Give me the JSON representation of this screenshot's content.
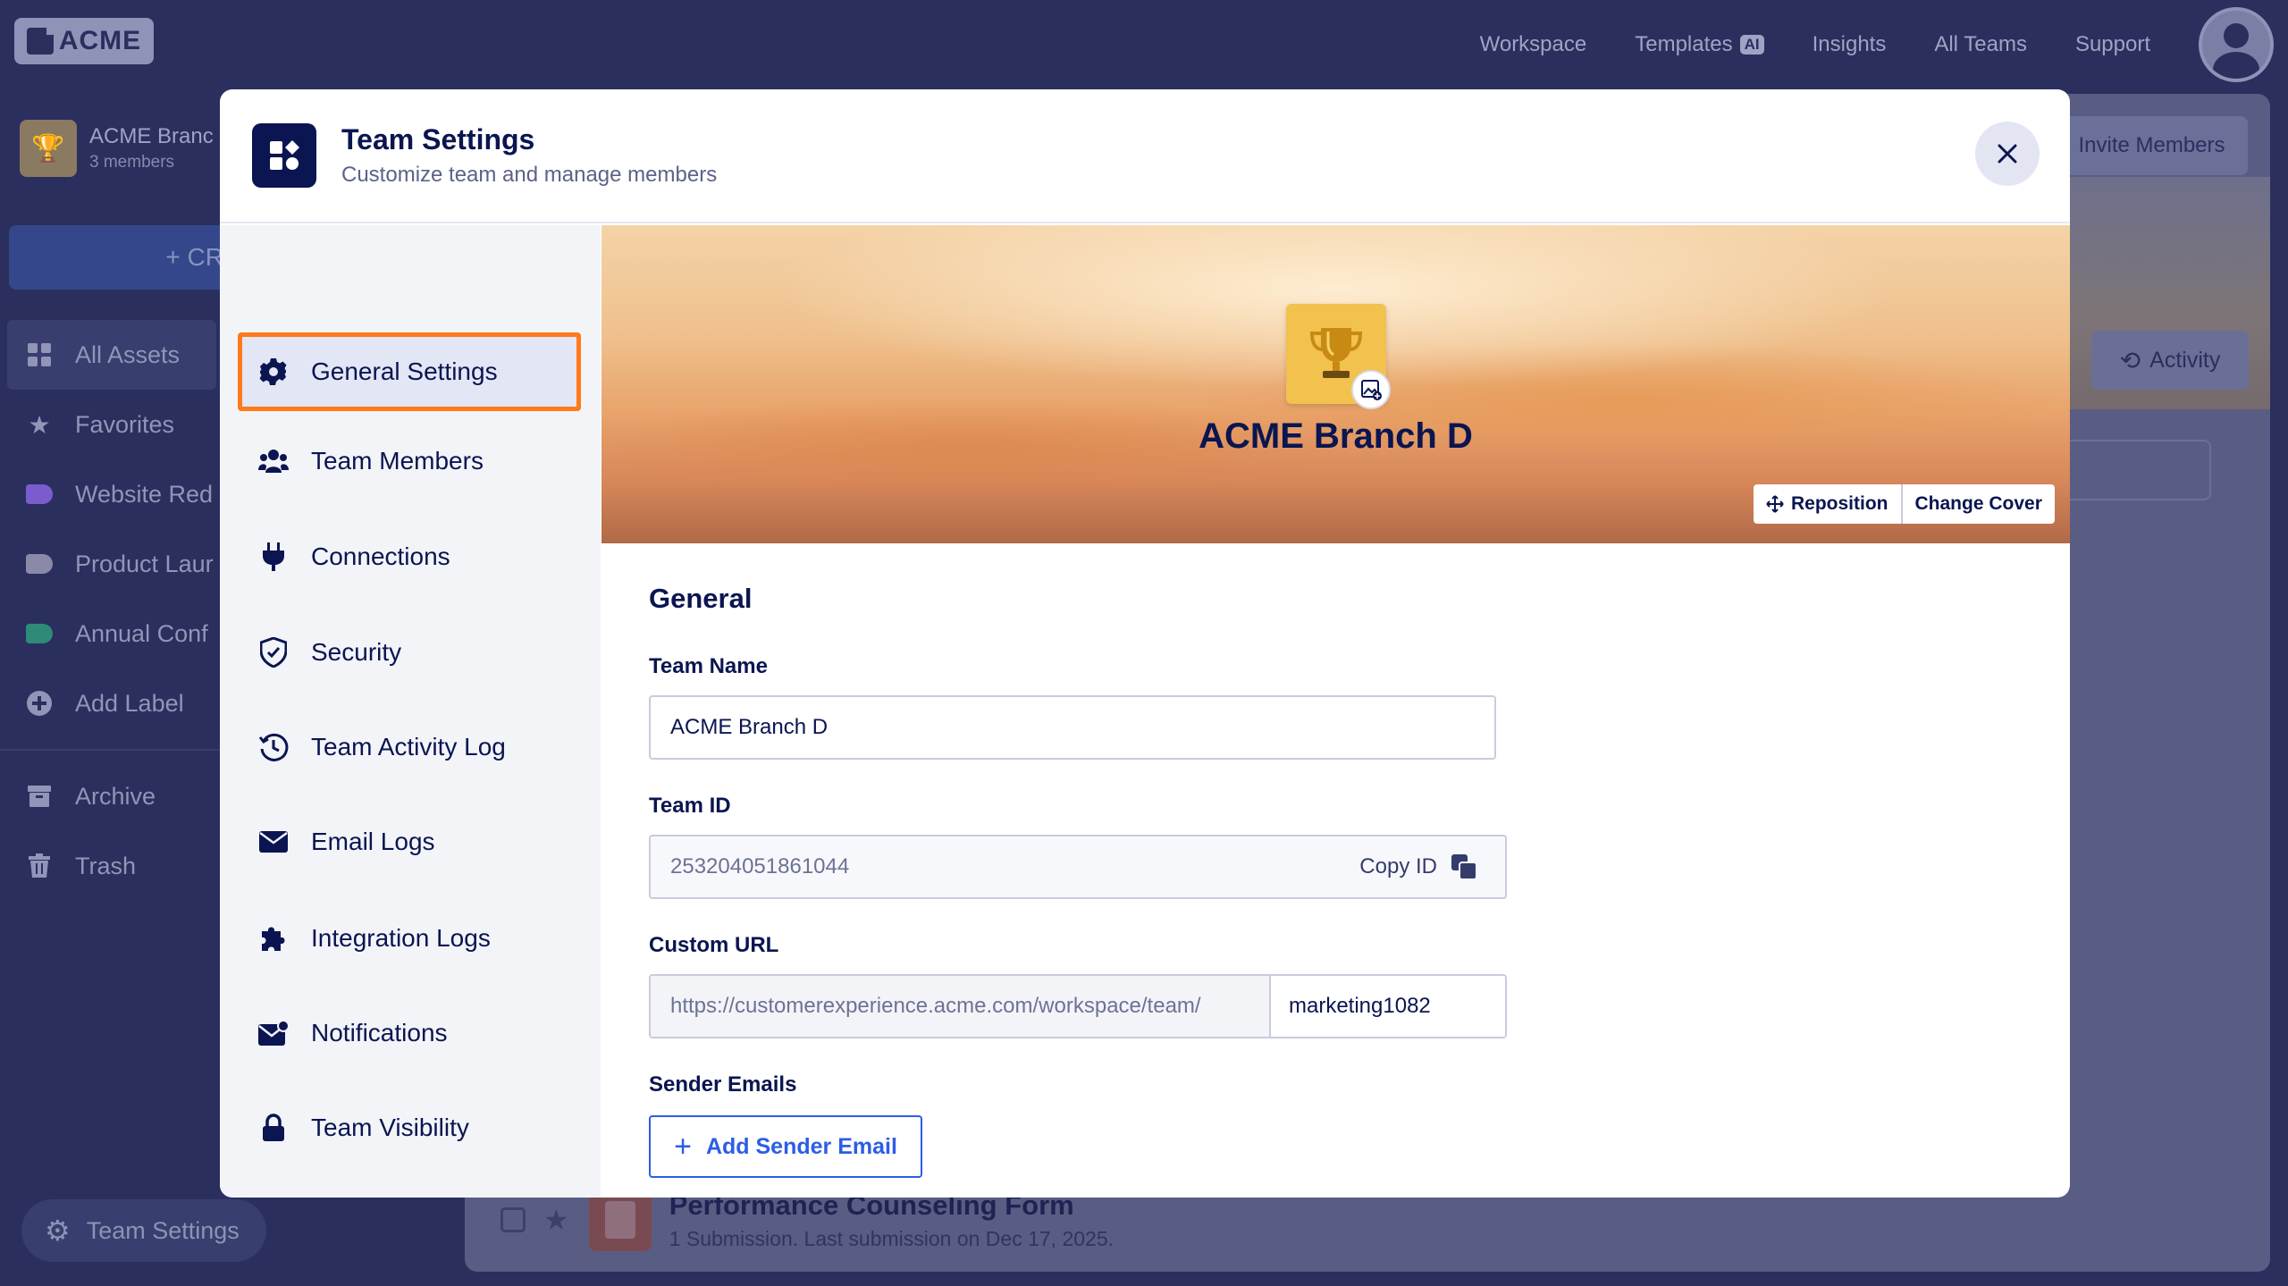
{
  "app": {
    "logo_text": "ACME",
    "nav": [
      {
        "label": "Workspace"
      },
      {
        "label": "Templates",
        "badge": "AI"
      },
      {
        "label": "Insights"
      },
      {
        "label": "All Teams"
      },
      {
        "label": "Support"
      }
    ]
  },
  "sidebar": {
    "team_name": "ACME Branc",
    "team_members": "3 members",
    "create_label": "+ CR",
    "items": [
      {
        "label": "All Assets",
        "icon": "grid-icon"
      },
      {
        "label": "Favorites",
        "icon": "star-icon"
      },
      {
        "label": "Website Red",
        "icon": "label-icon",
        "color": "#7b5ccf"
      },
      {
        "label": "Product Laur",
        "icon": "label-icon",
        "color": "#8a8aa8"
      },
      {
        "label": "Annual Conf",
        "icon": "label-icon",
        "color": "#2f8a78"
      },
      {
        "label": "Add Label",
        "icon": "plus-circle-icon"
      }
    ],
    "bottom_items": [
      {
        "label": "Archive",
        "icon": "archive-icon"
      },
      {
        "label": "Trash",
        "icon": "trash-icon"
      }
    ],
    "team_settings_label": "Team Settings"
  },
  "background": {
    "invite_label": "Invite Members",
    "activity_label": "Activity",
    "form_title": "Performance Counseling Form",
    "form_sub": "1 Submission.  Last submission on Dec 17, 2025."
  },
  "modal": {
    "title": "Team Settings",
    "subtitle": "Customize team and manage members",
    "close_icon": "close-icon",
    "nav": [
      {
        "label": "General Settings",
        "icon": "gear-icon",
        "selected": true
      },
      {
        "label": "Team Members",
        "icon": "users-icon"
      },
      {
        "label": "Connections",
        "icon": "plug-icon"
      },
      {
        "label": "Security",
        "icon": "shield-icon"
      },
      {
        "label": "Team Activity Log",
        "icon": "history-icon"
      },
      {
        "label": "Email Logs",
        "icon": "envelope-icon"
      },
      {
        "label": "Integration Logs",
        "icon": "puzzle-icon"
      },
      {
        "label": "Notifications",
        "icon": "mail-notification-icon"
      },
      {
        "label": "Team Visibility",
        "icon": "lock-icon"
      }
    ],
    "cover": {
      "team_name": "ACME Branch D",
      "reposition_label": "Reposition",
      "change_cover_label": "Change Cover"
    },
    "general": {
      "section_title": "General",
      "team_name_label": "Team Name",
      "team_name_value": "ACME Branch D",
      "team_id_label": "Team ID",
      "team_id_value": "253204051861044",
      "copy_id_label": "Copy ID",
      "custom_url_label": "Custom URL",
      "custom_url_prefix": "https://customerexperience.acme.com/workspace/team/",
      "custom_url_value": "marketing1082",
      "sender_emails_label": "Sender Emails",
      "add_sender_label": "Add Sender Email"
    }
  }
}
